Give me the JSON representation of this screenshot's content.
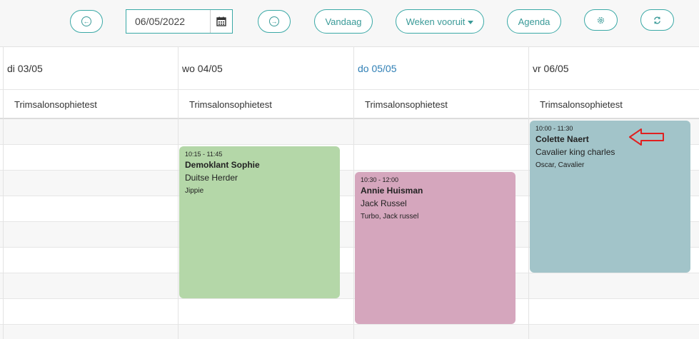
{
  "toolbar": {
    "prev_icon": "arrow-left-circle-icon",
    "date_value": "06/05/2022",
    "calendar_icon": "calendar-icon",
    "next_icon": "arrow-right-circle-icon",
    "today_label": "Vandaag",
    "weeks_label": "Weken vooruit",
    "agenda_label": "Agenda",
    "settings_icon": "gear-icon",
    "refresh_icon": "refresh-icon"
  },
  "days": [
    {
      "label": "di 03/05",
      "resource": "Trimsalonsophietest",
      "today": false
    },
    {
      "label": "wo 04/05",
      "resource": "Trimsalonsophietest",
      "today": false
    },
    {
      "label": "do 05/05",
      "resource": "Trimsalonsophietest",
      "today": true
    },
    {
      "label": "vr 06/05",
      "resource": "Trimsalonsophietest",
      "today": false
    }
  ],
  "events": [
    {
      "time": "10:15 - 11:45",
      "name": "Demoklant Sophie",
      "breed": "Duitse Herder",
      "pets": "Jippie",
      "color": "#b4d7a8"
    },
    {
      "time": "10:30 - 12:00",
      "name": "Annie Huisman",
      "breed": "Jack Russel",
      "pets": "Turbo, Jack russel",
      "color": "#d5a6bd"
    },
    {
      "time": "10:00 - 11:30",
      "name": "Colette Naert",
      "breed": "Cavalier king charles",
      "pets": "Oscar, Cavalier",
      "color": "#a2c4c9"
    }
  ],
  "colors": {
    "accent": "#3aa9a6",
    "today": "#2f7fb5",
    "annotation_arrow": "#e02020"
  }
}
